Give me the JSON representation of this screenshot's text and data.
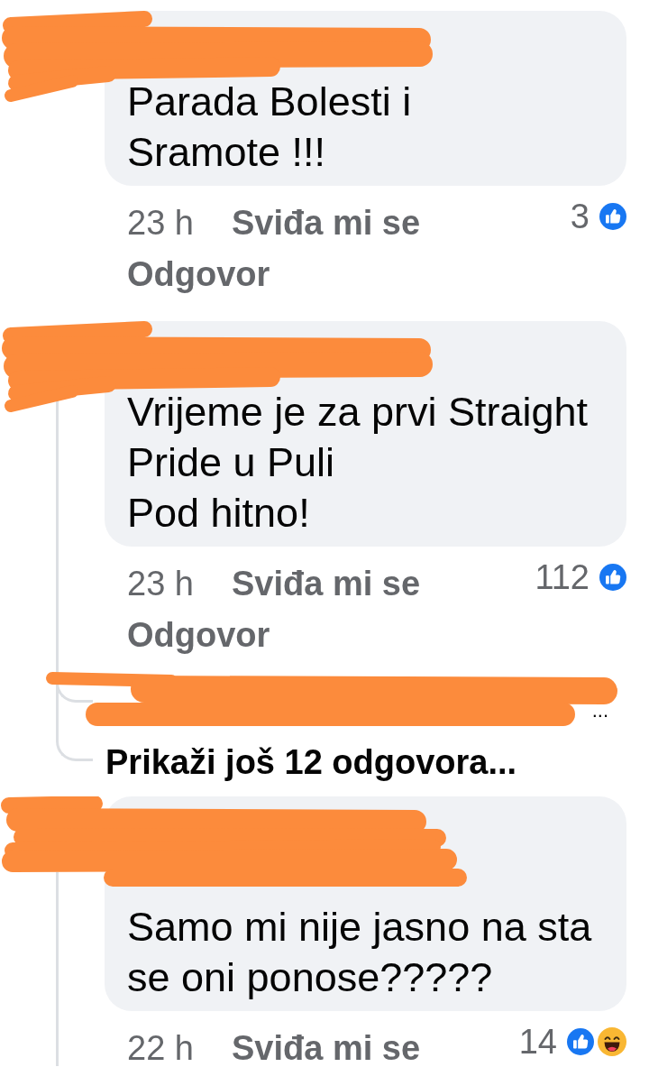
{
  "comments": [
    {
      "author_redacted": true,
      "badge_redacted": false,
      "text_lines": [
        "Parada Bolesti i",
        "Sramote !!!"
      ],
      "time": "23 h",
      "like_action": "Sviđa mi se",
      "reply_action": "Odgovor",
      "reaction_count": "3",
      "reactions": [
        {
          "kind": "like"
        }
      ],
      "has_replies": false
    },
    {
      "author_redacted": true,
      "badge_redacted": false,
      "text_lines": [
        "Vrijeme je za prvi Straight",
        "Pride u Puli",
        "Pod hitno!"
      ],
      "time": "23 h",
      "like_action": "Sviđa mi se",
      "reply_action": "Odgovor",
      "reaction_count": "112",
      "reactions": [
        {
          "kind": "like"
        }
      ],
      "has_replies": true,
      "reply_previews": [
        {
          "author_redacted": true,
          "text": "..."
        }
      ],
      "more_replies": "Prikaži još 12 odgovora..."
    },
    {
      "author_redacted": true,
      "badge_redacted": true,
      "text_lines": [
        "Samo mi nije jasno na sta",
        "se oni ponose?????"
      ],
      "time": "22 h",
      "like_action": "Sviđa mi se",
      "reaction_count": "14",
      "reactions": [
        {
          "kind": "like"
        },
        {
          "kind": "haha"
        }
      ],
      "has_replies": true
    }
  ]
}
